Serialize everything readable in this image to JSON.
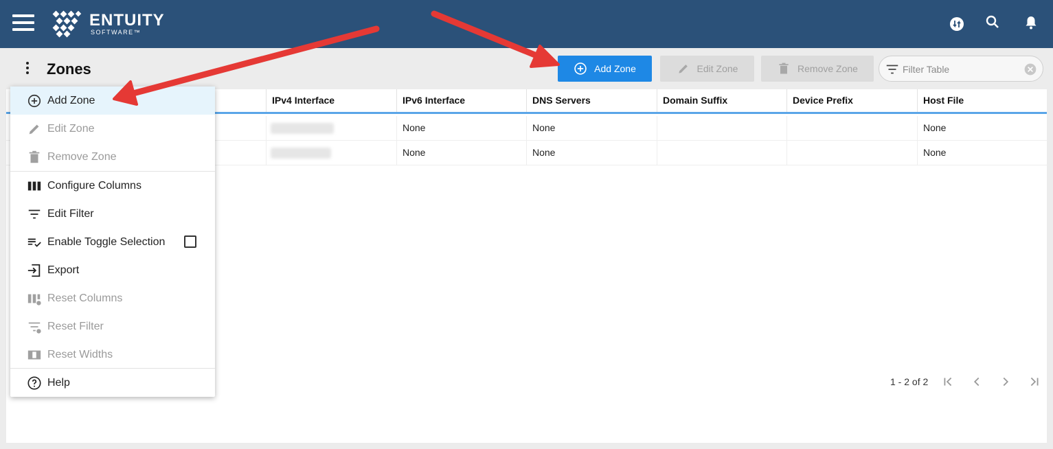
{
  "header": {
    "brand_main": "ENTUITY",
    "brand_sub": "SOFTWARE™",
    "icons": [
      "menu-icon",
      "sync-icon",
      "search-icon",
      "bell-icon"
    ]
  },
  "page": {
    "title": "Zones"
  },
  "toolbar": {
    "add_label": "Add Zone",
    "edit_label": "Edit Zone",
    "remove_label": "Remove Zone",
    "filter_placeholder": "Filter Table"
  },
  "table": {
    "columns": [
      "IPv4 Interface",
      "IPv6 Interface",
      "DNS Servers",
      "Domain Suffix",
      "Device Prefix",
      "Host File"
    ],
    "rows": [
      {
        "ipv6": "None",
        "dns": "None",
        "domain": "",
        "prefix": "",
        "host": "None"
      },
      {
        "ipv6": "None",
        "dns": "None",
        "domain": "",
        "prefix": "",
        "host": "None"
      }
    ]
  },
  "pager": {
    "range": "1 - 2 of 2"
  },
  "menu": {
    "items": [
      {
        "label": "Add Zone",
        "icon": "add-circle-icon",
        "state": "active"
      },
      {
        "label": "Edit Zone",
        "icon": "pencil-icon",
        "state": "disabled"
      },
      {
        "label": "Remove Zone",
        "icon": "trash-icon",
        "state": "disabled"
      },
      {
        "label": "Configure Columns",
        "icon": "columns-icon",
        "state": "enabled"
      },
      {
        "label": "Edit Filter",
        "icon": "filter-icon",
        "state": "enabled"
      },
      {
        "label": "Enable Toggle Selection",
        "icon": "toggle-selection-icon",
        "state": "enabled"
      },
      {
        "label": "Export",
        "icon": "export-icon",
        "state": "enabled"
      },
      {
        "label": "Reset Columns",
        "icon": "reset-columns-icon",
        "state": "disabled"
      },
      {
        "label": "Reset Filter",
        "icon": "reset-filter-icon",
        "state": "disabled"
      },
      {
        "label": "Reset Widths",
        "icon": "reset-widths-icon",
        "state": "disabled"
      },
      {
        "label": "Help",
        "icon": "help-icon",
        "state": "enabled"
      }
    ]
  },
  "colors": {
    "topbar": "#2b5179",
    "primary": "#1e88e5",
    "annotation_arrow": "#e53935",
    "active_menu": "#e6f4fc"
  }
}
